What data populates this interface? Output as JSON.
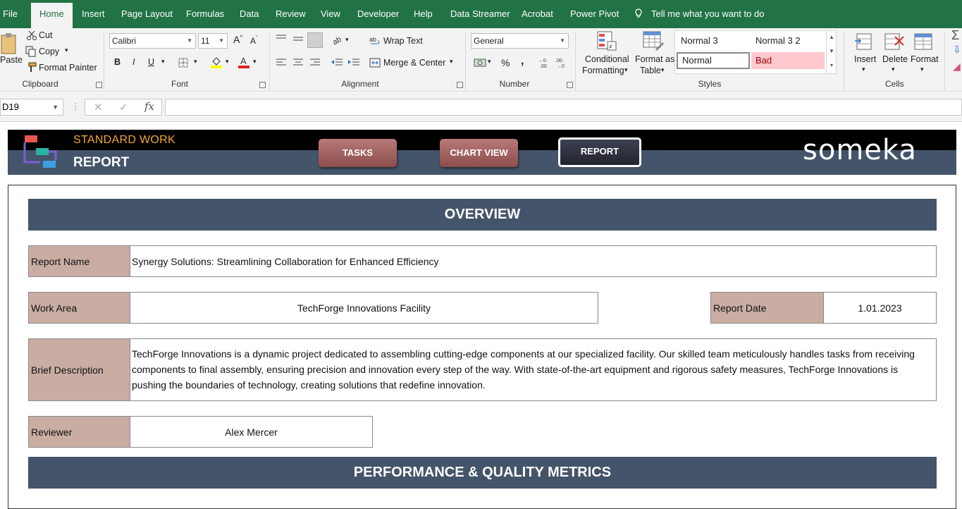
{
  "menu": {
    "file": "File",
    "home": "Home",
    "insert": "Insert",
    "page_layout": "Page Layout",
    "formulas": "Formulas",
    "data": "Data",
    "review": "Review",
    "view": "View",
    "developer": "Developer",
    "help": "Help",
    "data_streamer": "Data Streamer",
    "acrobat": "Acrobat",
    "power_pivot": "Power Pivot",
    "tell_me": "Tell me what you want to do"
  },
  "ribbon": {
    "clipboard": {
      "paste": "Paste",
      "cut": "Cut",
      "copy": "Copy",
      "format_painter": "Format Painter",
      "label": "Clipboard"
    },
    "font": {
      "name": "Calibri",
      "size": "11",
      "bold": "B",
      "italic": "I",
      "underline": "U",
      "label": "Font"
    },
    "alignment": {
      "wrap": "Wrap Text",
      "merge": "Merge & Center",
      "label": "Alignment"
    },
    "number": {
      "format": "General",
      "percent": "%",
      "comma": ",",
      "label": "Number"
    },
    "styles": {
      "conditional": "Conditional",
      "formatting": "Formatting",
      "format_as": "Format as",
      "table": "Table",
      "normal3": "Normal 3",
      "normal32": "Normal 3 2",
      "normal": "Normal",
      "bad": "Bad",
      "label": "Styles"
    },
    "cells": {
      "insert": "Insert",
      "delete": "Delete",
      "format": "Format",
      "label": "Cells"
    }
  },
  "formula_bar": {
    "name_box": "D19",
    "fx": "fx",
    "formula": ""
  },
  "banner": {
    "title_top": "STANDARD WORK",
    "title_bottom": "REPORT",
    "nav": {
      "tasks": "TASKS",
      "chart_view": "CHART VIEW",
      "report": "REPORT"
    },
    "logo": "someka"
  },
  "report": {
    "overview_title": "OVERVIEW",
    "fields": {
      "report_name_label": "Report Name",
      "report_name": "Synergy Solutions: Streamlining Collaboration for Enhanced Efficiency",
      "work_area_label": "Work Area",
      "work_area": "TechForge Innovations Facility",
      "report_date_label": "Report Date",
      "report_date": "1.01.2023",
      "brief_label": "Brief Description",
      "brief": "TechForge Innovations is a dynamic project dedicated to assembling cutting-edge components at our specialized facility. Our skilled team meticulously handles tasks from receiving components to final assembly, ensuring precision and innovation every step of the way. With state-of-the-art equipment and rigorous safety measures, TechForge Innovations is pushing the boundaries of technology, creating solutions that redefine innovation.",
      "reviewer_label": "Reviewer",
      "reviewer": "Alex Mercer"
    },
    "metrics_title": "PERFORMANCE & QUALITY METRICS"
  },
  "colors": {
    "excel_green": "#217346",
    "section_bar": "#44546a",
    "label_fill": "#c9aca2",
    "accent_orange": "#f0a830"
  }
}
